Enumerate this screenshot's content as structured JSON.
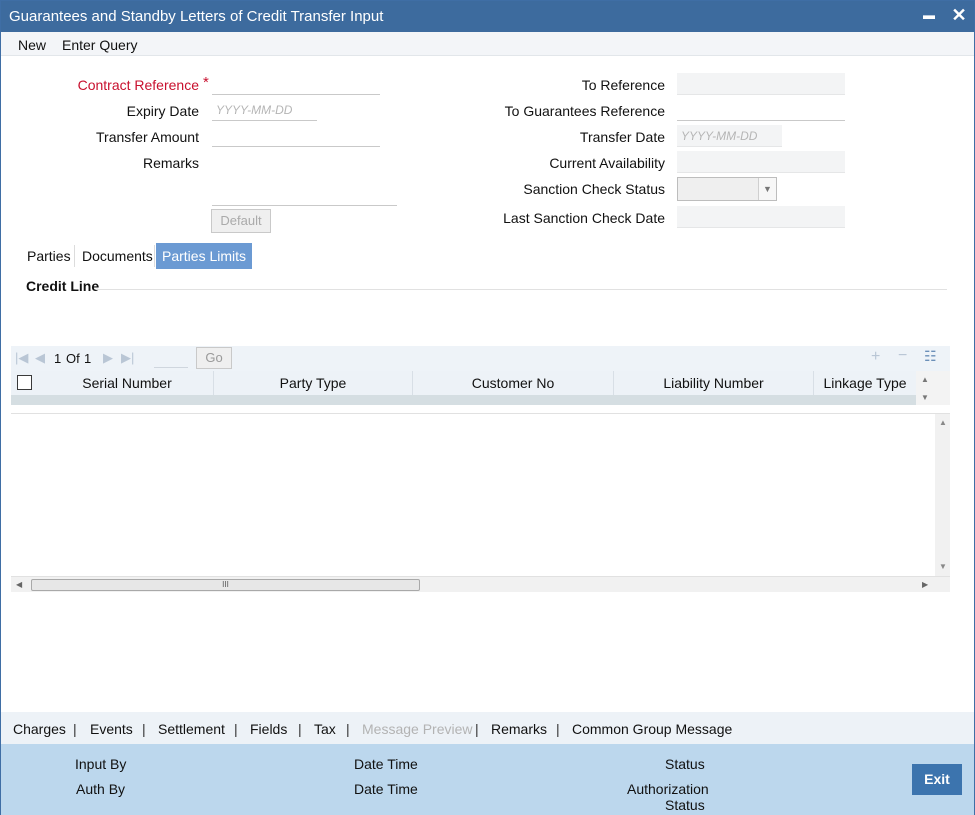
{
  "window": {
    "title": "Guarantees and Standby Letters of Credit Transfer Input",
    "minimize_glyph": "▬",
    "close_glyph": "✕"
  },
  "menu": {
    "items": [
      "New",
      "Enter Query"
    ]
  },
  "form": {
    "contract_reference": {
      "label": "Contract Reference",
      "required_mark": "*",
      "value": ""
    },
    "expiry_date": {
      "label": "Expiry Date",
      "placeholder": "YYYY-MM-DD"
    },
    "transfer_amount": {
      "label": "Transfer Amount",
      "value": ""
    },
    "remarks": {
      "label": "Remarks",
      "value": ""
    },
    "default_button": "Default",
    "to_reference": {
      "label": "To Reference",
      "value": ""
    },
    "to_guarantees_reference": {
      "label": "To Guarantees Reference",
      "value": ""
    },
    "transfer_date": {
      "label": "Transfer Date",
      "placeholder": "YYYY-MM-DD"
    },
    "current_availability": {
      "label": "Current Availability",
      "value": ""
    },
    "sanction_check_status": {
      "label": "Sanction Check Status",
      "value": ""
    },
    "last_sanction_check_date": {
      "label": "Last Sanction Check Date",
      "value": ""
    }
  },
  "tabs": [
    {
      "label": "Parties",
      "active": false
    },
    {
      "label": "Documents",
      "active": false
    },
    {
      "label": "Parties Limits",
      "active": true
    }
  ],
  "section": {
    "title": "Credit Line"
  },
  "pager": {
    "first_icon": "first-page-icon",
    "prev_icon": "prev-page-icon",
    "next_icon": "next-page-icon",
    "last_icon": "last-page-icon",
    "current": "1",
    "of_label": "Of",
    "total": "1",
    "go_label": "Go"
  },
  "grid": {
    "columns": [
      "Serial Number",
      "Party Type",
      "Customer No",
      "Liability Number",
      "Linkage Type"
    ],
    "rows": []
  },
  "scrollbar": {
    "thumb_grip": "III"
  },
  "bottom_links": [
    {
      "label": "Charges",
      "disabled": false
    },
    {
      "label": "Events",
      "disabled": false
    },
    {
      "label": "Settlement",
      "disabled": false
    },
    {
      "label": "Fields",
      "disabled": false
    },
    {
      "label": "Tax",
      "disabled": false
    },
    {
      "label": "Message Preview",
      "disabled": true
    },
    {
      "label": "Remarks",
      "disabled": false
    },
    {
      "label": "Common Group Message",
      "disabled": false
    }
  ],
  "link_separator": "|",
  "footer": {
    "input_by": "Input By",
    "auth_by": "Auth By",
    "date_time_1": "Date Time",
    "date_time_2": "Date Time",
    "status": "Status",
    "authorization_status_1": "Authorization",
    "authorization_status_2": "Status",
    "exit": "Exit"
  },
  "colors": {
    "titlebar": "#3d6b9e",
    "active_tab": "#6b9ad3",
    "footer": "#bcd7ed",
    "exit_button": "#3c74ae",
    "required": "#c8102e"
  }
}
